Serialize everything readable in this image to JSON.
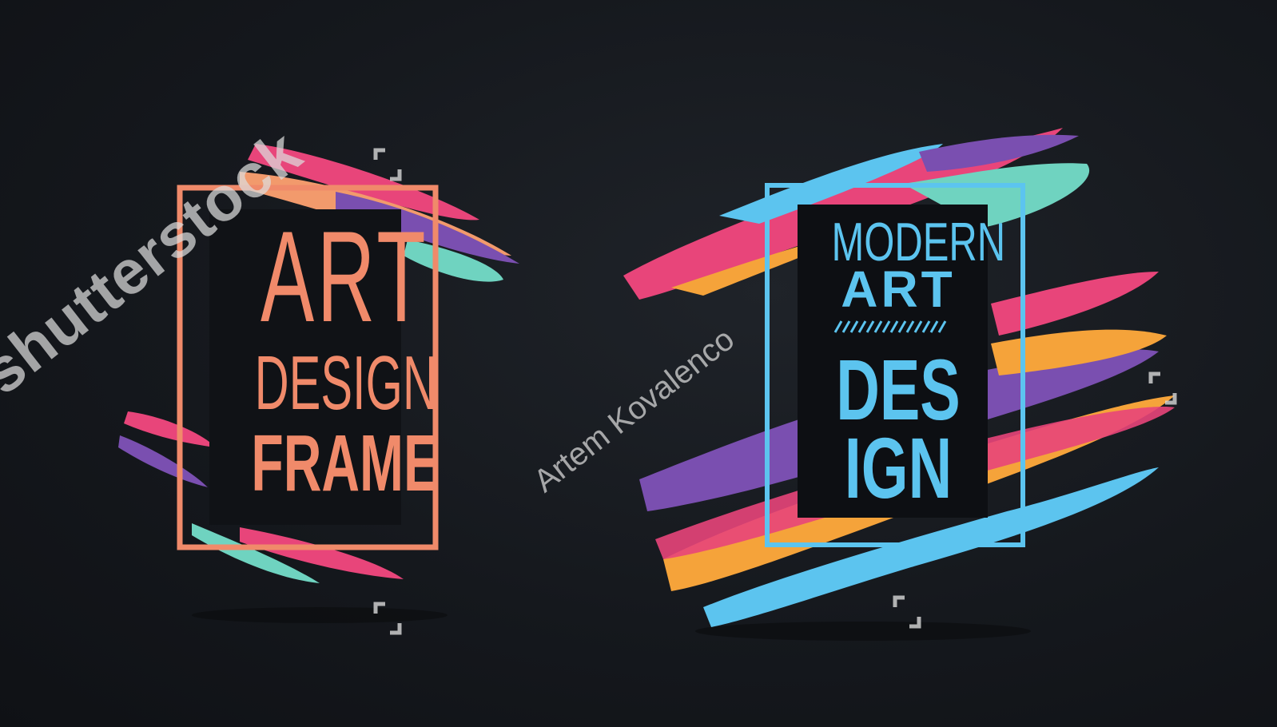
{
  "left_artwork": {
    "line1": "ART",
    "line2": "DESIGN",
    "line3": "FRAME",
    "accent_color": "#f08a6a"
  },
  "right_artwork": {
    "line1": "MODERN",
    "line2": "ART",
    "line3": "DES",
    "line4": "IGN",
    "accent_color": "#5cc4ef"
  },
  "watermark": {
    "brand": "shutterstock",
    "author": "Artem Kovalenco"
  },
  "icons": [
    "watermark-corner-icon"
  ],
  "colors": {
    "background": "#15181d",
    "pink": "#e8457a",
    "orange": "#f5a33a",
    "purple": "#7a4fb0",
    "teal": "#6fd3c0",
    "cyan": "#5cc4ef"
  }
}
